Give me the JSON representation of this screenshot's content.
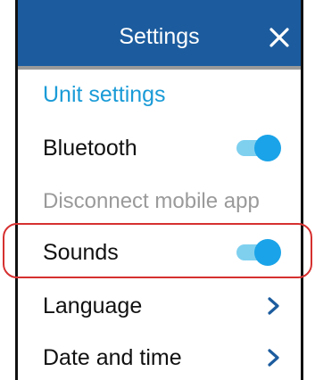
{
  "header": {
    "title": "Settings",
    "close_icon": "close-icon"
  },
  "menu": {
    "section_title": "Unit settings",
    "items": [
      {
        "label": "Bluetooth",
        "control": "toggle",
        "on": true
      },
      {
        "label": "Disconnect mobile app",
        "control": "none",
        "disabled": true
      },
      {
        "label": "Sounds",
        "control": "toggle",
        "on": true,
        "highlighted": true
      },
      {
        "label": "Language",
        "control": "chevron",
        "icon": "chevron-right-icon"
      },
      {
        "label": "Date and time",
        "control": "chevron",
        "icon": "chevron-right-icon"
      }
    ]
  },
  "colors": {
    "header_bg": "#1c5c9e",
    "accent": "#1aa3e8",
    "section_text": "#1a9bd7",
    "disabled_text": "#9a9a9a",
    "highlight_outline": "#d63030"
  }
}
